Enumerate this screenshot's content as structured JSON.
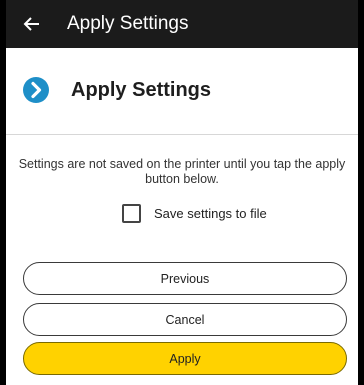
{
  "topbar": {
    "title": "Apply Settings",
    "back_icon": "arrow-left-icon"
  },
  "header": {
    "title": "Apply Settings",
    "icon": "circle-arrow-right-icon",
    "icon_color": "#1e8fc8"
  },
  "info": {
    "text": "Settings are not saved on the printer until you tap the apply button below."
  },
  "save_option": {
    "label": "Save settings to file",
    "checked": false
  },
  "buttons": {
    "previous_label": "Previous",
    "cancel_label": "Cancel",
    "apply_label": "Apply",
    "apply_color": "#ffd200"
  },
  "colors": {
    "topbar_bg": "#1b1b1b",
    "accent": "#1e8fc8"
  }
}
